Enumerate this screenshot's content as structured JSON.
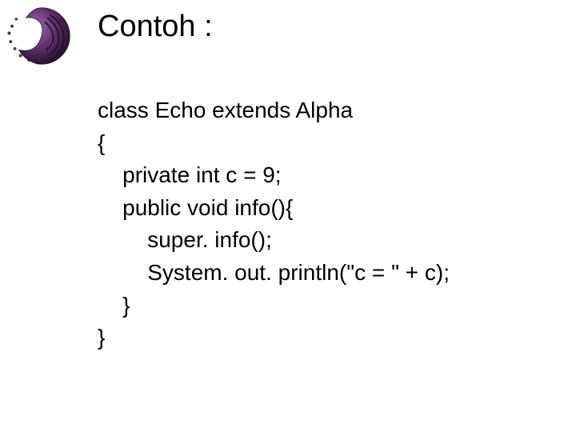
{
  "title": "Contoh :",
  "code": {
    "l1": "class Echo extends Alpha",
    "l2": "{",
    "l3": "    private int c = 9;",
    "l4": "    public void info(){",
    "l5": "        super. info();",
    "l6": "        System. out. println(\"c = \" + c);",
    "l7": "    }",
    "l8": "}"
  }
}
